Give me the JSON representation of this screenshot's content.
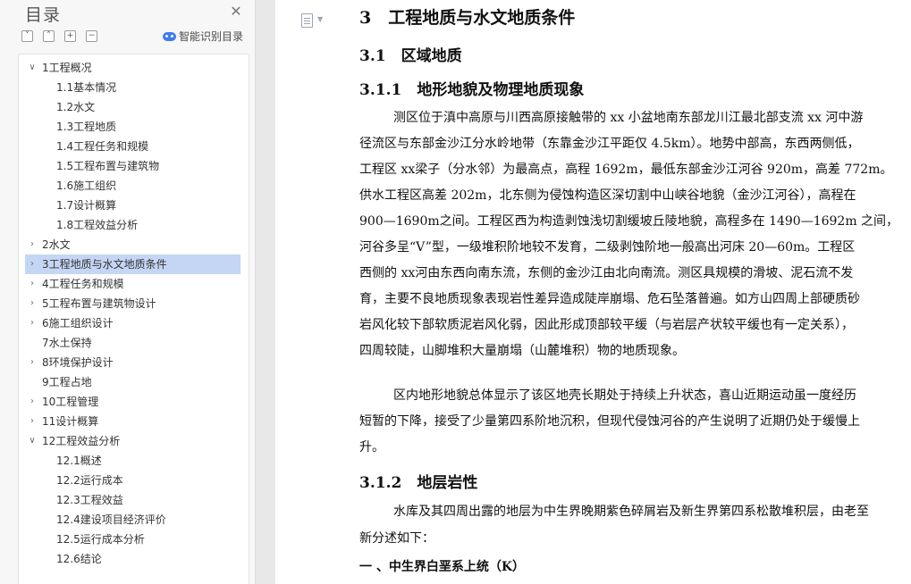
{
  "toc": {
    "title": "目录",
    "smart_label": "智能识别目录",
    "items": [
      {
        "label": "1工程概况",
        "level": 1,
        "caret": "down"
      },
      {
        "label": "1.1基本情况",
        "level": 2
      },
      {
        "label": "1.2水文",
        "level": 2
      },
      {
        "label": "1.3工程地质",
        "level": 2
      },
      {
        "label": "1.4工程任务和规模",
        "level": 2
      },
      {
        "label": "1.5工程布置与建筑物",
        "level": 2
      },
      {
        "label": "1.6施工组织",
        "level": 2
      },
      {
        "label": "1.7设计概算",
        "level": 2
      },
      {
        "label": "1.8工程效益分析",
        "level": 2
      },
      {
        "label": "2水文",
        "level": 1,
        "caret": "right"
      },
      {
        "label": "3工程地质与水文地质条件",
        "level": 1,
        "caret": "right",
        "selected": true
      },
      {
        "label": "4工程任务和规模",
        "level": 1,
        "caret": "right"
      },
      {
        "label": "5工程布置与建筑物设计",
        "level": 1,
        "caret": "right"
      },
      {
        "label": "6施工组织设计",
        "level": 1,
        "caret": "right"
      },
      {
        "label": "7水土保持",
        "level": 1
      },
      {
        "label": "8环境保护设计",
        "level": 1,
        "caret": "right"
      },
      {
        "label": "9工程占地",
        "level": 1
      },
      {
        "label": "10工程管理",
        "level": 1,
        "caret": "right"
      },
      {
        "label": "11设计概算",
        "level": 1,
        "caret": "right"
      },
      {
        "label": "12工程效益分析",
        "level": 1,
        "caret": "down"
      },
      {
        "label": "12.1概述",
        "level": 2
      },
      {
        "label": "12.2运行成本",
        "level": 2
      },
      {
        "label": "12.3工程效益",
        "level": 2
      },
      {
        "label": "12.4建设项目经济评价",
        "level": 2
      },
      {
        "label": "12.5运行成本分析",
        "level": 2
      },
      {
        "label": "12.6结论",
        "level": 2
      }
    ]
  },
  "document": {
    "chapter": "3　工程地质与水文地质条件",
    "section_1": "3.1　区域地质",
    "subsection_1": "3.1.1　地形地貌及物理地质现象",
    "para1": [
      "测区位于滇中高原与川西高原接触带的 xx 小盆地南东部龙川江最北部支流 xx 河中游",
      "径流区与东部金沙江分水岭地带（东靠金沙江平距仅 4.5km）。地势中部高，东西两侧低，",
      "工程区 xx梁子（分水邻）为最高点，高程 1692m，最低东部金沙江河谷 920m，高差 772m。",
      "供水工程区高差 202m，北东侧为侵蚀构造区深切割中山峡谷地貌（金沙江河谷），高程在",
      "900—1690m之间。工程区西为构造剥蚀浅切割缓坡丘陵地貌，高程多在 1490—1692m 之间，",
      "河谷多呈“V”型，一级堆积阶地较不发育，二级剥蚀阶地一般高出河床 20—60m。工程区",
      "西侧的 xx河由东西向南东流，东侧的金沙江由北向南流。测区具规模的滑坡、泥石流不发",
      "育，主要不良地质现象表现岩性差异造成陡岸崩塌、危石坠落普遍。如方山四周上部硬质砂",
      "岩风化较下部软质泥岩风化弱，因此形成顶部较平缓（与岩层产状较平缓也有一定关系），",
      "四周较陡，山脚堆积大量崩塌（山麓堆积）物的地质现象。"
    ],
    "para2": [
      "区内地形地貌总体显示了该区地壳长期处于持续上升状态，喜山近期运动虽一度经历",
      "短暂的下降，接受了少量第四系阶地沉积，但现代侵蚀河谷的产生说明了近期仍处于缓慢上",
      "升。"
    ],
    "subsection_2": "3.1.2　地层岩性",
    "para3": [
      "水库及其四周出露的地层为中生界晚期紫色碎屑岩及新生界第四系松散堆积层，由老至",
      "新分述如下："
    ],
    "subheading": "一 、中生界白垩系上统（K）"
  }
}
